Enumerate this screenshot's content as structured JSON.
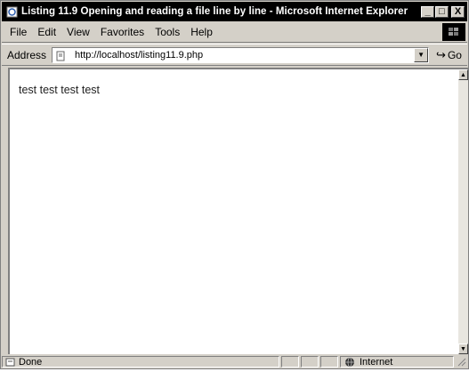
{
  "window": {
    "title": "Listing 11.9 Opening and reading a file line by line - Microsoft Internet Explorer",
    "controls": [
      "_",
      "□",
      "X"
    ]
  },
  "menubar": {
    "items": [
      "File",
      "Edit",
      "View",
      "Favorites",
      "Tools",
      "Help"
    ]
  },
  "address_bar": {
    "label": "Address",
    "url": "http://localhost/listing11.9.php",
    "go_label": "Go",
    "go_arrow": "↪"
  },
  "content": {
    "text": "test test test test"
  },
  "statusbar": {
    "status": "Done",
    "zone": "Internet"
  },
  "colors": {
    "title_bar": "#000000",
    "chrome": "#d4d0c8",
    "page_bg": "#ffffff"
  }
}
